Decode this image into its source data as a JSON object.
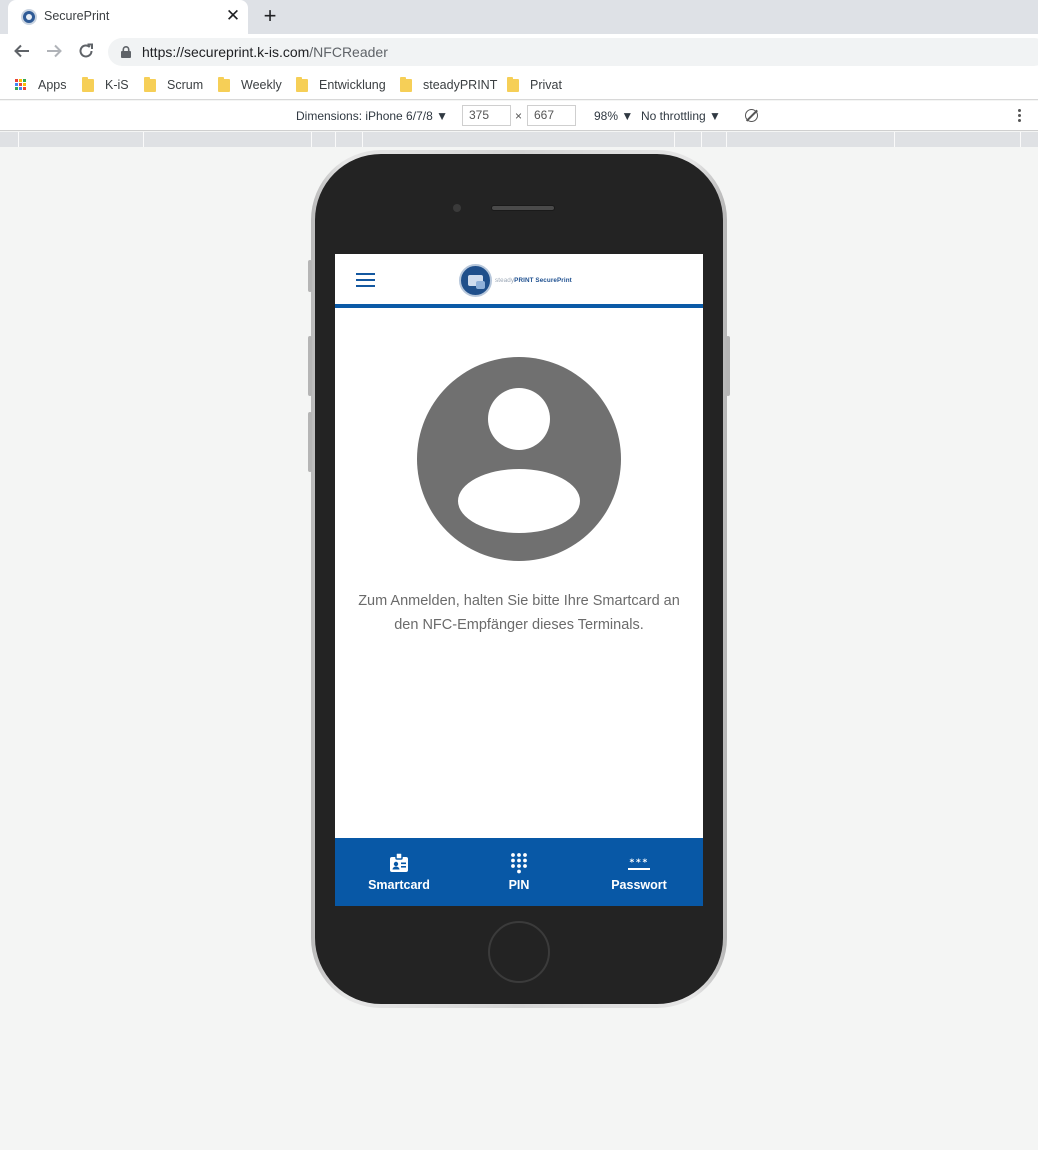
{
  "browser": {
    "tab_title": "SecurePrint",
    "tab_close_glyph": "✕",
    "new_tab_glyph": "+",
    "url_host": "https://secureprint.k-is.com",
    "url_path": "/NFCReader"
  },
  "bookmarks": [
    {
      "label": "Apps",
      "icon": "apps-grid-icon"
    },
    {
      "label": "K-iS",
      "icon": "folder-icon"
    },
    {
      "label": "Scrum",
      "icon": "folder-icon"
    },
    {
      "label": "Weekly",
      "icon": "folder-icon"
    },
    {
      "label": "Entwicklung",
      "icon": "folder-icon"
    },
    {
      "label": "steadyPRINT",
      "icon": "folder-icon"
    },
    {
      "label": "Privat",
      "icon": "folder-icon"
    }
  ],
  "devtools": {
    "dimensions_label": "Dimensions: iPhone 6/7/8 ▼",
    "width_value": "375",
    "times": "×",
    "height_value": "667",
    "zoom": "98% ▼",
    "throttling": "No throttling ▼"
  },
  "app": {
    "logo_prefix": "steady",
    "logo_brand": "PRINT",
    "logo_suffix": "SecurePrint",
    "login_text": "Zum Anmelden, halten Sie bitte Ihre Smartcard an den NFC-Empfänger dieses Terminals.",
    "nav": {
      "smartcard": "Smartcard",
      "pin": "PIN",
      "password": "Passwort"
    }
  },
  "colors": {
    "brand_blue": "#0858a6",
    "avatar_gray": "#707070",
    "text_gray": "#6b6b6b"
  }
}
